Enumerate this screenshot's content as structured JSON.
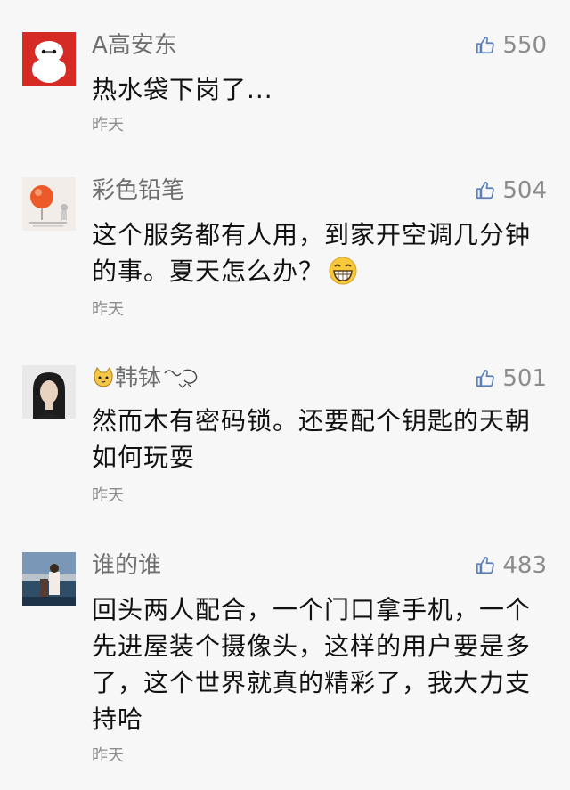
{
  "comments": [
    {
      "name": "A高安东",
      "likes": "550",
      "text": "热水袋下岗了...",
      "time": "昨天",
      "avatar_icon": "white-robot-avatar"
    },
    {
      "name": "彩色铅笔",
      "likes": "504",
      "text": "这个服务都有人用，到家开空调几分钟的事。夏天怎么办？",
      "time": "昨天",
      "avatar_icon": "balloon-avatar",
      "emoji": "grinning-face-emoji"
    },
    {
      "name": "韩钵",
      "likes": "501",
      "text": "然而木有密码锁。还要配个钥匙的天朝如何玩耍",
      "time": "昨天",
      "avatar_icon": "girl-photo-avatar",
      "name_prefix_icon": "cat-icon",
      "name_suffix_icon": "scribble-icon"
    },
    {
      "name": "谁的谁",
      "likes": "483",
      "text": "回头两人配合，一个门口拿手机，一个先进屋装个摄像头，这样的用户要是多了，这个世界就真的精彩了，我大力支持哈",
      "time": "昨天",
      "avatar_icon": "seaside-photo-avatar"
    }
  ],
  "colors": {
    "background": "#f7f7f7",
    "name": "#6f6f6f",
    "meta": "#8c8c8c",
    "text": "#111111"
  }
}
